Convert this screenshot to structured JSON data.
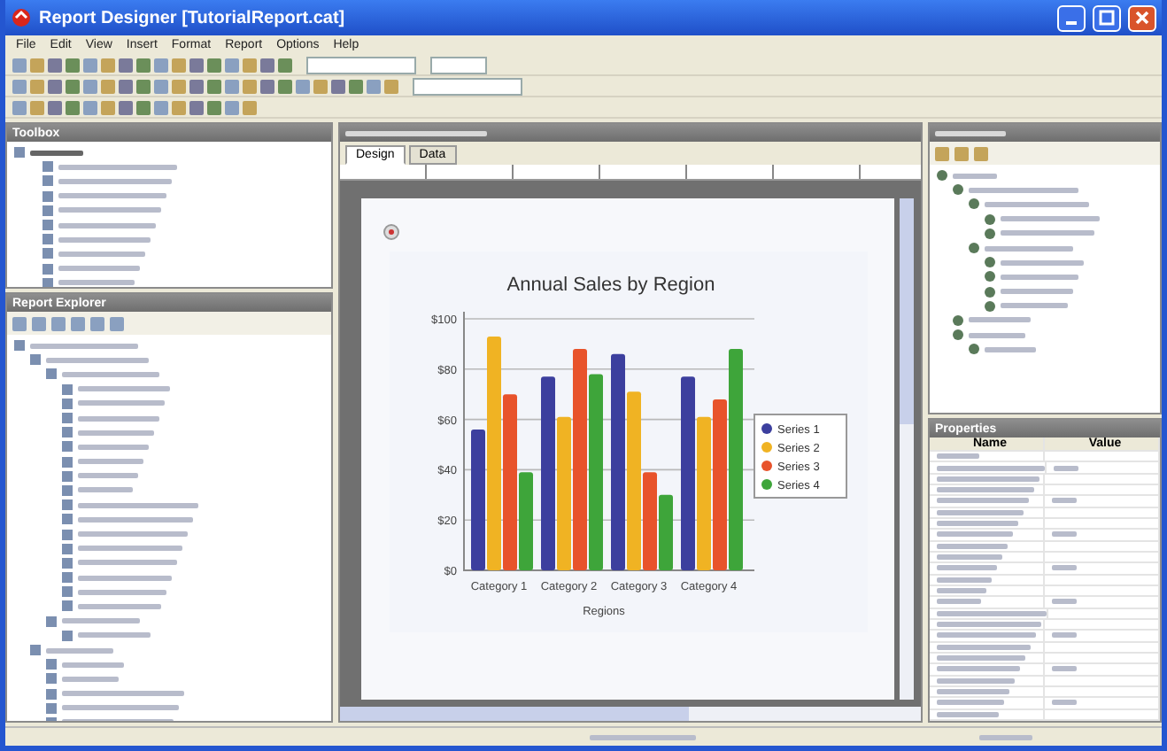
{
  "window": {
    "title": "Report Designer [TutorialReport.cat]"
  },
  "menu": [
    "File",
    "Edit",
    "View",
    "Insert",
    "Format",
    "Report",
    "Options",
    "Help"
  ],
  "toolbox": {
    "title": "Toolbox"
  },
  "explorer": {
    "title": "Report Explorer"
  },
  "designer": {
    "tabs": [
      {
        "label": "Design",
        "selected": true
      },
      {
        "label": "Data",
        "selected": false
      }
    ],
    "chart_data": {
      "type": "bar",
      "title": "Annual Sales by Region",
      "xlabel": "Regions",
      "categories": [
        "Category 1",
        "Category 2",
        "Category 3",
        "Category 4"
      ],
      "series": [
        {
          "name": "Series 1",
          "color": "#3c3f9e",
          "values": [
            56,
            77,
            86,
            77
          ]
        },
        {
          "name": "Series 2",
          "color": "#f0b323",
          "values": [
            93,
            61,
            71,
            61
          ]
        },
        {
          "name": "Series 3",
          "color": "#e8532b",
          "values": [
            70,
            88,
            39,
            68
          ]
        },
        {
          "name": "Series 4",
          "color": "#3ea53a",
          "values": [
            39,
            78,
            30,
            88
          ]
        }
      ],
      "grid": true,
      "legend": true,
      "ylim": [
        0,
        100
      ],
      "yticks": [
        {
          "value": 0,
          "label": "$0"
        },
        {
          "value": 20,
          "label": "$20"
        },
        {
          "value": 40,
          "label": "$40"
        },
        {
          "value": 60,
          "label": "$60"
        },
        {
          "value": 80,
          "label": "$80"
        },
        {
          "value": 100,
          "label": "$100"
        }
      ]
    }
  },
  "properties": {
    "title": "Properties",
    "columns": [
      "Name",
      "Value"
    ]
  }
}
